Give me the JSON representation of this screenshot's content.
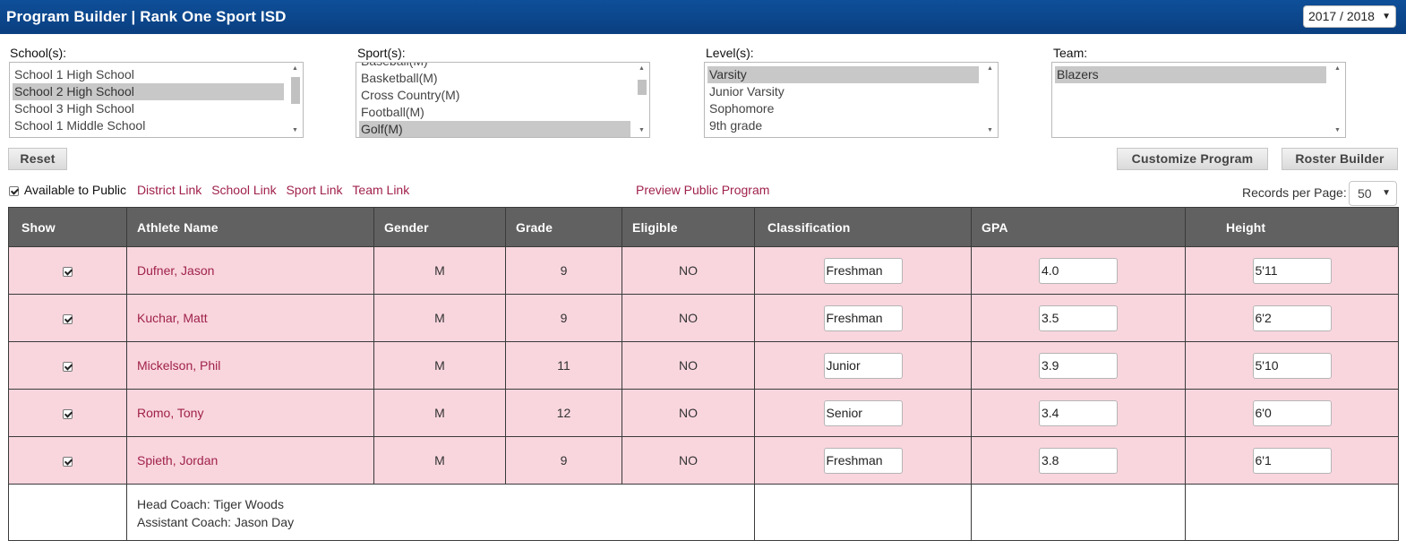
{
  "header": {
    "title": "Program Builder | Rank One Sport ISD",
    "year": "2017 / 2018"
  },
  "filters": {
    "schools": {
      "label": "School(s):",
      "items": [
        "School 1 High School",
        "School 2 High School",
        "School 3 High School",
        "School 1 Middle School"
      ],
      "selected": "School 2 High School"
    },
    "sports": {
      "label": "Sport(s):",
      "items": [
        "Baseball(M)",
        "Basketball(M)",
        "Cross Country(M)",
        "Football(M)",
        "Golf(M)"
      ],
      "selected": "Golf(M)"
    },
    "levels": {
      "label": "Level(s):",
      "items": [
        "Varsity",
        "Junior Varsity",
        "Sophomore",
        "9th grade"
      ],
      "selected": "Varsity"
    },
    "teams": {
      "label": "Team:",
      "items": [
        "Blazers"
      ],
      "selected": "Blazers"
    }
  },
  "buttons": {
    "reset": "Reset",
    "customize": "Customize Program",
    "roster_builder": "Roster Builder"
  },
  "public_row": {
    "available_label": "Available to Public",
    "district_link": "District Link",
    "school_link": "School Link",
    "sport_link": "Sport Link",
    "team_link": "Team Link",
    "preview_link": "Preview Public Program"
  },
  "records_per_page": {
    "label": "Records per Page:",
    "value": "50"
  },
  "table": {
    "headers": [
      "Show",
      "Athlete Name",
      "Gender",
      "Grade",
      "Eligible",
      "Classification",
      "GPA",
      "Height"
    ],
    "rows": [
      {
        "name": "Dufner, Jason",
        "gender": "M",
        "grade": "9",
        "eligible": "NO",
        "classification": "Freshman",
        "gpa": "4.0",
        "height": "5'11"
      },
      {
        "name": "Kuchar, Matt",
        "gender": "M",
        "grade": "9",
        "eligible": "NO",
        "classification": "Freshman",
        "gpa": "3.5",
        "height": "6'2"
      },
      {
        "name": "Mickelson, Phil",
        "gender": "M",
        "grade": "11",
        "eligible": "NO",
        "classification": "Junior",
        "gpa": "3.9",
        "height": "5'10"
      },
      {
        "name": "Romo, Tony",
        "gender": "M",
        "grade": "12",
        "eligible": "NO",
        "classification": "Senior",
        "gpa": "3.4",
        "height": "6'0"
      },
      {
        "name": "Spieth, Jordan",
        "gender": "M",
        "grade": "9",
        "eligible": "NO",
        "classification": "Freshman",
        "gpa": "3.8",
        "height": "6'1"
      }
    ],
    "coaches": [
      "Head Coach: Tiger Woods",
      "Assistant Coach: Jason Day"
    ]
  },
  "colors": {
    "header_bg": "#0b4488",
    "link": "#a0224b",
    "row_bg": "#f9d6de",
    "table_header_bg": "#616161"
  }
}
